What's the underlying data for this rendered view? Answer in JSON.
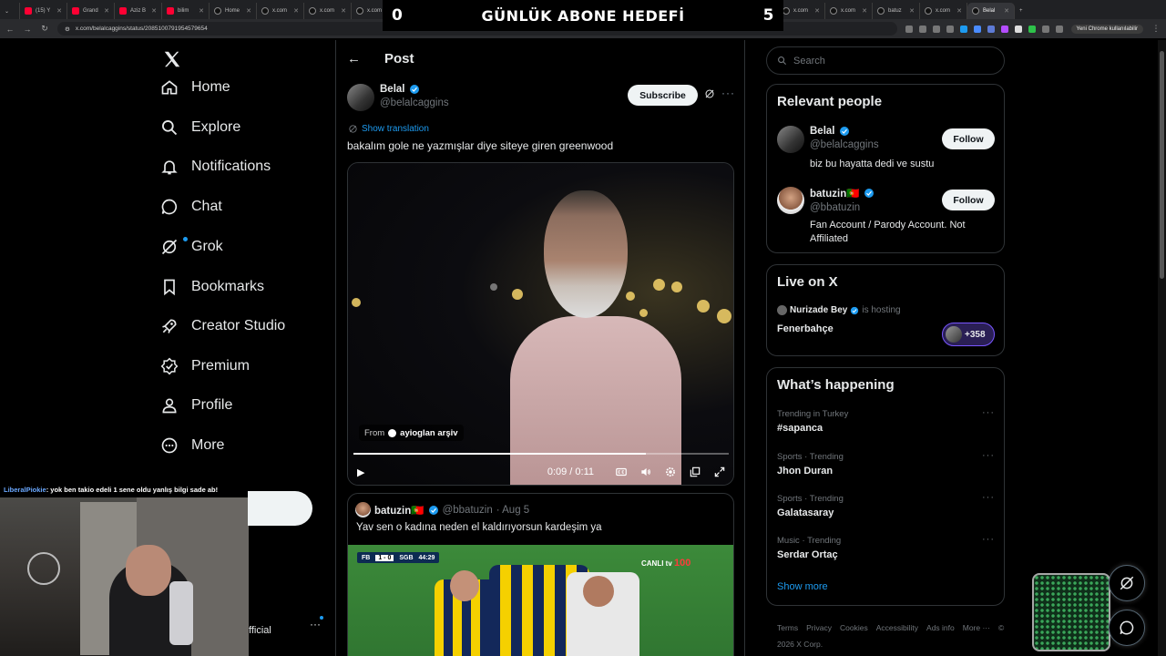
{
  "browser": {
    "tabs": [
      {
        "label": "(15) Y",
        "icon": "youtube-icon"
      },
      {
        "label": "Grand",
        "icon": "youtube-icon"
      },
      {
        "label": "Aziz B",
        "icon": "youtube-icon"
      },
      {
        "label": "bilim",
        "icon": "youtube-icon"
      },
      {
        "label": "Home",
        "icon": "x-icon"
      },
      {
        "label": "x.com",
        "icon": "x-icon"
      },
      {
        "label": "x.com",
        "icon": "x-icon"
      },
      {
        "label": "x.com",
        "icon": "x-icon"
      },
      {
        "label": "x.com",
        "icon": "x-icon"
      },
      {
        "label": "x.com",
        "icon": "x-icon"
      },
      {
        "label": "x.com",
        "icon": "x-icon"
      },
      {
        "label": "x.com",
        "icon": "x-icon"
      },
      {
        "label": "x.com",
        "icon": "x-icon"
      },
      {
        "label": "x.com",
        "icon": "x-icon"
      },
      {
        "label": "x.com",
        "icon": "x-icon"
      },
      {
        "label": "x.com",
        "icon": "x-icon"
      },
      {
        "label": "x.com",
        "icon": "x-icon"
      },
      {
        "label": "x.com",
        "icon": "x-icon"
      },
      {
        "label": "batuz",
        "icon": "x-icon"
      },
      {
        "label": "x.com",
        "icon": "x-icon"
      },
      {
        "label": "Belal",
        "icon": "x-icon"
      }
    ],
    "url": "x.com/belalcaggins/status/2085100791954579654",
    "profile_chip": "Yeni Chrome kullanılabilir"
  },
  "stream_overlay": {
    "left_count": "0",
    "goal_text": "GÜNLÜK ABONE HEDEFİ",
    "right_count": "5",
    "chat_user": "LiberalPiokie",
    "chat_message": ": yok ben takio edeli 1 sene oldu yanlış bilgi sade ab!",
    "partial_label": "fficial"
  },
  "nav": {
    "items": [
      {
        "label": "Home",
        "icon": "home-icon"
      },
      {
        "label": "Explore",
        "icon": "search-icon"
      },
      {
        "label": "Notifications",
        "icon": "bell-icon"
      },
      {
        "label": "Chat",
        "icon": "chat-bubble-icon"
      },
      {
        "label": "Grok",
        "icon": "grok-icon"
      },
      {
        "label": "Bookmarks",
        "icon": "bookmark-icon"
      },
      {
        "label": "Creator Studio",
        "icon": "rocket-icon"
      },
      {
        "label": "Premium",
        "icon": "verified-badge-icon"
      },
      {
        "label": "Profile",
        "icon": "person-icon"
      },
      {
        "label": "More",
        "icon": "more-circle-icon"
      }
    ]
  },
  "post": {
    "header_title": "Post",
    "author_name": "Belal",
    "author_handle": "@belalcaggins",
    "subscribe_label": "Subscribe",
    "translate_label": "Show translation",
    "text": "bakalım gole ne yazmışlar diye siteye giren greenwood",
    "video": {
      "from_label": "From",
      "from_source": "ayioglan arşiv",
      "time": "0:09 / 0:11",
      "progress": 0.78
    },
    "quote": {
      "name": "batuzin🇵🇹",
      "handle": "@bbatuzin",
      "date": "· Aug 5",
      "text": "Yav sen o kadına neden el kaldırıyorsun kardeşim ya",
      "score_home": "FB",
      "score": "1 - 0",
      "score_away": "SGB",
      "match_time": "44:29",
      "channel": "CANLI tv",
      "channel_number": "100"
    }
  },
  "sidebar": {
    "search_placeholder": "Search",
    "relevant_title": "Relevant people",
    "people": [
      {
        "name": "Belal",
        "handle": "@belalcaggins",
        "bio": "biz bu hayatta dedi ve sustu",
        "follow": "Follow"
      },
      {
        "name": "batuzin🇵🇹",
        "handle": "@bbatuzin",
        "bio": "Fan Account / Parody Account. Not Affiliated",
        "follow": "Follow"
      }
    ],
    "live_title": "Live on X",
    "live_host": "Nurizade Bey",
    "live_hosting": "is hosting",
    "live_space": "Fenerbahçe",
    "live_count": "+358",
    "happening_title": "What’s happening",
    "trends": [
      {
        "meta": "Trending in Turkey",
        "topic": "#sapanca"
      },
      {
        "meta": "Sports · Trending",
        "topic": "Jhon Duran"
      },
      {
        "meta": "Sports · Trending",
        "topic": "Galatasaray"
      },
      {
        "meta": "Music · Trending",
        "topic": "Serdar Ortaç"
      }
    ],
    "show_more": "Show more",
    "footer": [
      "Terms",
      "Privacy",
      "Cookies",
      "Accessibility",
      "Ads info",
      "More ···",
      "© 2026 X Corp."
    ]
  },
  "colors": {
    "accent": "#1d9bf0",
    "background": "#000000",
    "border": "#2f3336",
    "muted": "#71767b"
  }
}
